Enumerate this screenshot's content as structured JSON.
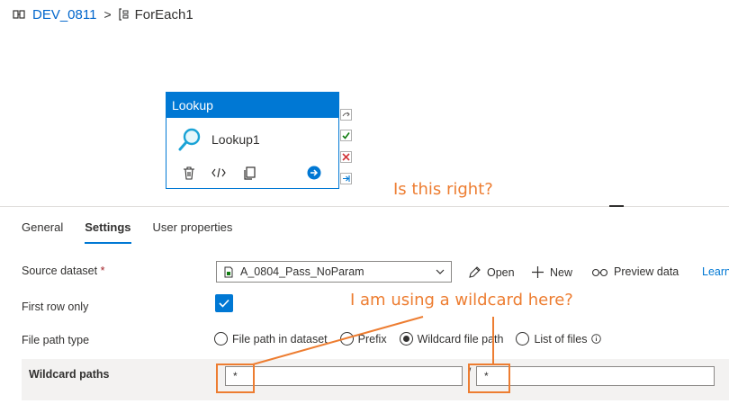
{
  "breadcrumb": {
    "pipeline": "DEV_0811",
    "separator": ">",
    "activity": "ForEach1"
  },
  "activity_card": {
    "type_title": "Lookup",
    "name": "Lookup1"
  },
  "annotations": {
    "question_right": "Is this right?",
    "question_wildcard": "I am using a wildcard here?"
  },
  "tabs": [
    {
      "label": "General"
    },
    {
      "label": "Settings"
    },
    {
      "label": "User properties"
    }
  ],
  "settings": {
    "source_dataset": {
      "label": "Source dataset",
      "required_mark": "*",
      "value": "A_0804_Pass_NoParam",
      "actions": {
        "open": "Open",
        "new": "New",
        "preview": "Preview data",
        "learn": "Learn"
      }
    },
    "first_row_only": {
      "label": "First row only",
      "checked": true
    },
    "file_path_type": {
      "label": "File path type",
      "options": [
        "File path in dataset",
        "Prefix",
        "Wildcard file path",
        "List of files"
      ],
      "selected": "Wildcard file path"
    },
    "wildcard_paths": {
      "label": "Wildcard paths",
      "folder_value": "*",
      "separator": "/",
      "file_value": "*"
    }
  },
  "colors": {
    "accent": "#0078d4",
    "annotation": "#ed7d31",
    "link": "#0066cc"
  },
  "icons": [
    "pipeline-icon",
    "foreach-icon",
    "lookup-search-icon",
    "delete-icon",
    "code-icon",
    "copy-icon",
    "go-icon",
    "skip-port-icon",
    "success-port-icon",
    "failure-port-icon",
    "completion-port-icon",
    "pencil-icon",
    "plus-icon",
    "glasses-icon",
    "chevron-down-icon",
    "info-icon",
    "checkmark-icon"
  ]
}
